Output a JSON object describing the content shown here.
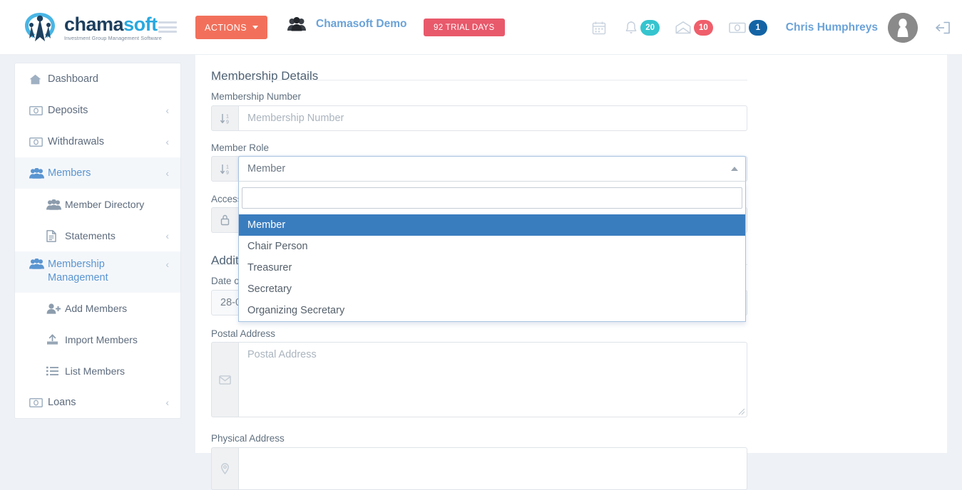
{
  "brand": {
    "name_dark": "chama",
    "name_light": "soft",
    "tagline": "Investment Group Management Software",
    "accent_coral": "#f2705b",
    "accent_blue": "#6aa2d8"
  },
  "topbar": {
    "menu_toggle": "menu-toggle",
    "actions_label": "ACTIONS",
    "group_name": "Chamasoft Demo",
    "trial_label": "92 TRIAL DAYS",
    "calendar_icon": "calendar-icon",
    "notifications": {
      "icon": "bell-icon",
      "count": "20",
      "color": "#35c5cf"
    },
    "messages": {
      "icon": "envelope-icon",
      "count": "10",
      "color": "#ef5f6b"
    },
    "transactions": {
      "icon": "money-icon",
      "count": "1",
      "color": "#1464a5"
    },
    "user_name": "Chris Humphreys",
    "avatar_icon": "user-avatar-icon",
    "logout_icon": "logout-icon"
  },
  "sidebar": {
    "items": [
      {
        "label": "Dashboard",
        "icon": "home-icon",
        "arrow": "",
        "level": "top",
        "active": false
      },
      {
        "label": "Deposits",
        "icon": "money-icon",
        "arrow": "‹",
        "level": "top",
        "active": false
      },
      {
        "label": "Withdrawals",
        "icon": "money-icon",
        "arrow": "‹",
        "level": "top",
        "active": false
      },
      {
        "label": "Members",
        "icon": "group-icon",
        "arrow": "‹",
        "level": "top",
        "active": true
      },
      {
        "label": "Member Directory",
        "icon": "group-icon",
        "arrow": "",
        "level": "sub",
        "active": false
      },
      {
        "label": "Statements",
        "icon": "document-icon",
        "arrow": "‹",
        "level": "sub",
        "active": false
      },
      {
        "label": "Membership Management",
        "icon": "group-icon",
        "arrow": "‹",
        "level": "top",
        "active": true
      },
      {
        "label": "Add Members",
        "icon": "user-plus-icon",
        "arrow": "",
        "level": "sub",
        "active": false
      },
      {
        "label": "Import Members",
        "icon": "upload-icon",
        "arrow": "",
        "level": "sub",
        "active": false
      },
      {
        "label": "List Members",
        "icon": "list-icon",
        "arrow": "",
        "level": "sub",
        "active": false
      },
      {
        "label": "Loans",
        "icon": "money-icon",
        "arrow": "‹",
        "level": "top",
        "active": false
      }
    ]
  },
  "main": {
    "section_membership_title": "Membership Details",
    "section_additional_title": "Additional",
    "fields": {
      "membership_number": {
        "label": "Membership Number",
        "placeholder": "Membership Number",
        "value": "",
        "addon_icon": "sort-numeric-icon"
      },
      "member_role": {
        "label": "Member Role",
        "selected": "Member",
        "addon_icon": "sort-numeric-icon"
      },
      "access_level": {
        "label": "Access",
        "addon_icon": "lock-icon"
      },
      "date_of": {
        "label": "Date o",
        "value": "28-0"
      },
      "postal_address": {
        "label": "Postal Address",
        "placeholder": "Postal Address",
        "value": "",
        "addon_icon": "envelope-icon"
      },
      "physical_address": {
        "label": "Physical Address",
        "placeholder": "",
        "value": "",
        "addon_icon": "map-marker-icon"
      }
    },
    "role_dropdown": {
      "search_value": "",
      "search_placeholder": "",
      "highlight_color": "#3a7dbf",
      "options": [
        "Member",
        "Chair Person",
        "Treasurer",
        "Secretary",
        "Organizing Secretary"
      ],
      "highlighted_index": 0
    }
  }
}
